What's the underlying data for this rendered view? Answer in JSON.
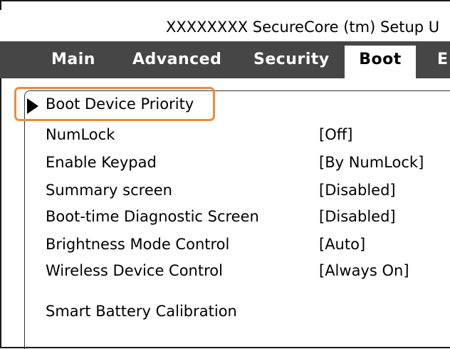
{
  "title": "XXXXXXXX SecureCore (tm) Setup U",
  "tabs": [
    {
      "label": "Main"
    },
    {
      "label": "Advanced"
    },
    {
      "label": "Security"
    },
    {
      "label": "Boot"
    },
    {
      "label": "E"
    }
  ],
  "active_tab": "Boot",
  "boot_menu": {
    "submenu": "Boot Device Priority",
    "settings": [
      {
        "label": "NumLock",
        "value": "[Off]"
      },
      {
        "label": "Enable Keypad",
        "value": "[By NumLock]"
      },
      {
        "label": "Summary screen",
        "value": "[Disabled]"
      },
      {
        "label": "Boot-time Diagnostic Screen",
        "value": "[Disabled]"
      },
      {
        "label": "Brightness Mode Control",
        "value": "[Auto]"
      },
      {
        "label": "Wireless Device Control",
        "value": "[Always On]"
      }
    ],
    "action": "Smart Battery Calibration"
  },
  "colors": {
    "menubar": "#464646",
    "highlight": "#f08a3c"
  }
}
